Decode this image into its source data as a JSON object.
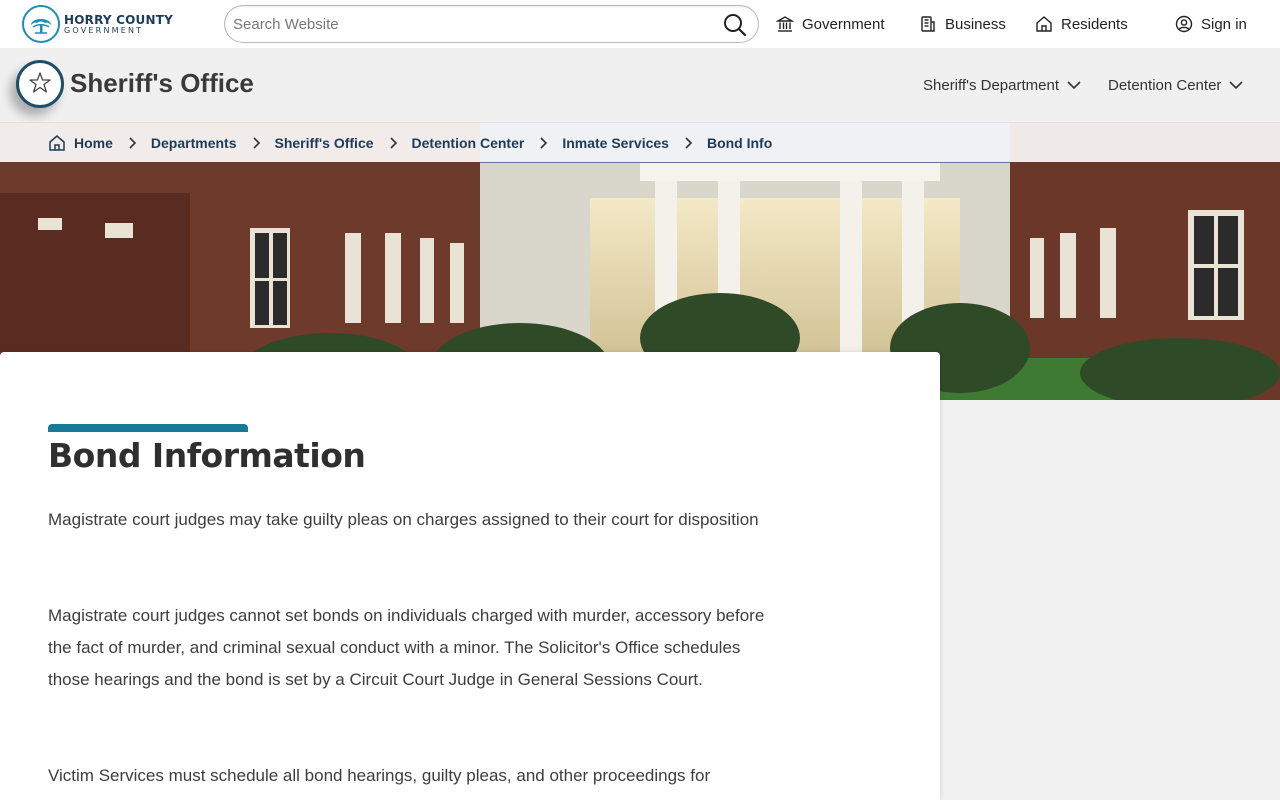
{
  "site": {
    "logo_line1": "HORRY COUNTY",
    "logo_line2": "GOVERNMENT"
  },
  "search": {
    "placeholder": "Search Website"
  },
  "topnav": {
    "government": "Government",
    "business": "Business",
    "residents": "Residents",
    "sign_in": "Sign in"
  },
  "department": {
    "title": "Sheriff's Office",
    "nav": [
      "Sheriff's Department",
      "Detention Center"
    ]
  },
  "breadcrumb": [
    "Home",
    "Departments",
    "Sheriff's Office",
    "Detention Center",
    "Inmate Services",
    "Bond Info"
  ],
  "main": {
    "heading": "Bond Information",
    "paragraphs": [
      "Magistrate court judges may take guilty pleas on charges assigned to their court for disposition",
      "Magistrate court judges cannot set bonds on individuals charged with murder, accessory before the fact of murder, and criminal sexual conduct with a minor.  The Solicitor's Office schedules those hearings and the bond is set by a Circuit Court Judge in General Sessions Court.",
      "Victim Services must schedule all bond hearings, guilty pleas, and other proceedings for"
    ]
  },
  "colors": {
    "accent": "#1a7a99",
    "brand_navy": "#1d3b5a",
    "badge_ring": "#1d4f66"
  },
  "icons": [
    "search-icon",
    "government-icon",
    "business-icon",
    "residents-icon",
    "user-icon",
    "star-badge-icon",
    "chevron-down-icon",
    "home-icon",
    "chevron-right-icon"
  ]
}
